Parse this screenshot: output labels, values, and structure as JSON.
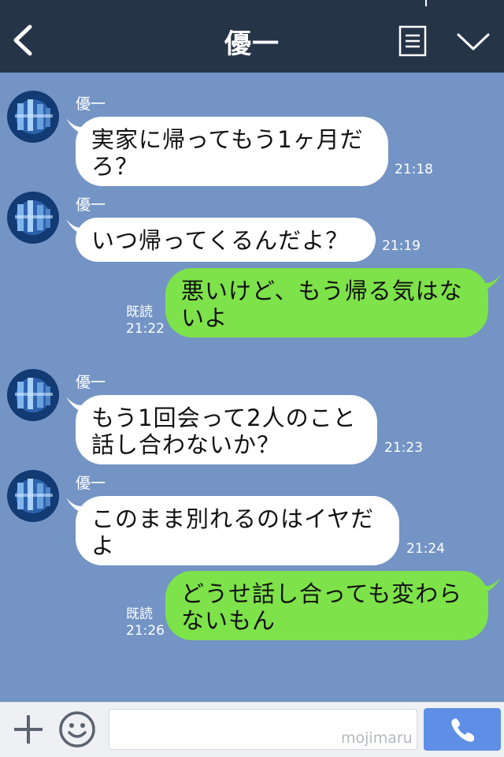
{
  "header": {
    "title": "優一",
    "icons": {
      "back": "chevron-left-icon",
      "menu": "document-list-icon",
      "toggle": "chevron-down-icon"
    }
  },
  "messages": [
    {
      "direction": "in",
      "sender": "優一",
      "text": "実家に帰ってもう1ヶ月だろ？",
      "lines": [
        "実家に帰ってもう1ヶ月だ",
        "ろ？"
      ],
      "time": "21:18"
    },
    {
      "direction": "in",
      "sender": "優一",
      "text": "いつ帰ってくるんだよ？",
      "lines": [
        "いつ帰ってくるんだよ？"
      ],
      "time": "21:19"
    },
    {
      "direction": "out",
      "read": "既読",
      "text": "悪いけど、もう帰る気はないよ",
      "lines": [
        "悪いけど、もう帰る気はな",
        "いよ"
      ],
      "time": "21:22"
    },
    {
      "direction": "in",
      "sender": "優一",
      "text": "もう1回会って2人のこと話し合わないか？",
      "lines": [
        "もう1回会って2人のこと",
        "話し合わないか？"
      ],
      "time": "21:23"
    },
    {
      "direction": "in",
      "sender": "優一",
      "text": "このまま別れるのはイヤだよ",
      "lines": [
        "このまま別れるのはイヤだ",
        "よ"
      ],
      "time": "21:24"
    },
    {
      "direction": "out",
      "read": "既読",
      "text": "どうせ話し合っても変わらないもん",
      "lines": [
        "どうせ話し合っても変わら",
        "ないもん"
      ],
      "time": "21:26"
    }
  ],
  "footer": {
    "input_value": "",
    "watermark": "mojimaru",
    "icons": {
      "add": "plus-icon",
      "emoji": "smiley-icon",
      "call": "phone-icon"
    }
  },
  "colors": {
    "background": "#7394c4",
    "header": "#263448",
    "incoming_bubble": "#ffffff",
    "outgoing_bubble": "#7ee24a",
    "call_button": "#5f8ee6"
  }
}
